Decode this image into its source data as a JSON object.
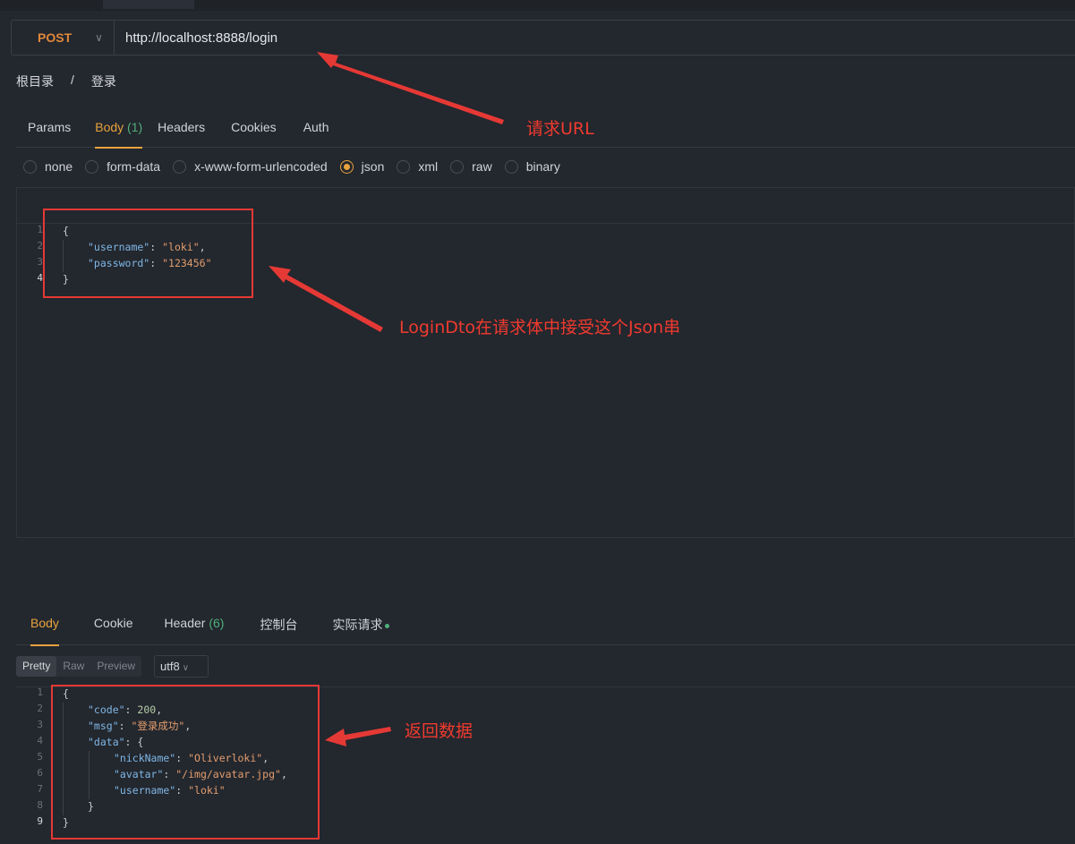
{
  "request": {
    "method": "POST",
    "url": "http://localhost:8888/login"
  },
  "breadcrumb": {
    "root": "根目录",
    "sep": "/",
    "current": "登录"
  },
  "request_tabs": [
    {
      "label": "Params"
    },
    {
      "label": "Body",
      "count": "(1)"
    },
    {
      "label": "Headers"
    },
    {
      "label": "Cookies"
    },
    {
      "label": "Auth"
    }
  ],
  "body_types": [
    "none",
    "form-data",
    "x-www-form-urlencoded",
    "json",
    "xml",
    "raw",
    "binary"
  ],
  "selected_body_type": "json",
  "request_body": {
    "line_numbers": [
      "1",
      "2",
      "3",
      "4"
    ],
    "open": "{",
    "close": "}",
    "fields": [
      {
        "key": "\"username\"",
        "value": "\"loki\"",
        "tail": ","
      },
      {
        "key": "\"password\"",
        "value": "\"123456\"",
        "tail": ""
      }
    ]
  },
  "response_tabs": [
    {
      "label": "Body"
    },
    {
      "label": "Cookie"
    },
    {
      "label": "Header",
      "count": "(6)"
    },
    {
      "label": "控制台"
    },
    {
      "label": "实际请求"
    }
  ],
  "view_modes": [
    "Pretty",
    "Raw",
    "Preview"
  ],
  "encoding": "utf8",
  "response_body": {
    "line_numbers": [
      "1",
      "2",
      "3",
      "4",
      "5",
      "6",
      "7",
      "8",
      "9"
    ],
    "code_key": "\"code\"",
    "code_val": "200",
    "msg_key": "\"msg\"",
    "msg_val": "\"登录成功\"",
    "data_key": "\"data\"",
    "nick_key": "\"nickName\"",
    "nick_val": "\"Oliverloki\"",
    "avatar_key": "\"avatar\"",
    "avatar_val": "\"/img/avatar.jpg\"",
    "user_key": "\"username\"",
    "user_val": "\"loki\""
  },
  "annotations": {
    "url": "请求URL",
    "body": "LoginDto在请求体中接受这个Json串",
    "response": "返回数据"
  },
  "colors": {
    "accent": "#e8a33d",
    "annotation": "#e53935",
    "json_key": "#7fb7e6",
    "json_string": "#e39d6e"
  }
}
